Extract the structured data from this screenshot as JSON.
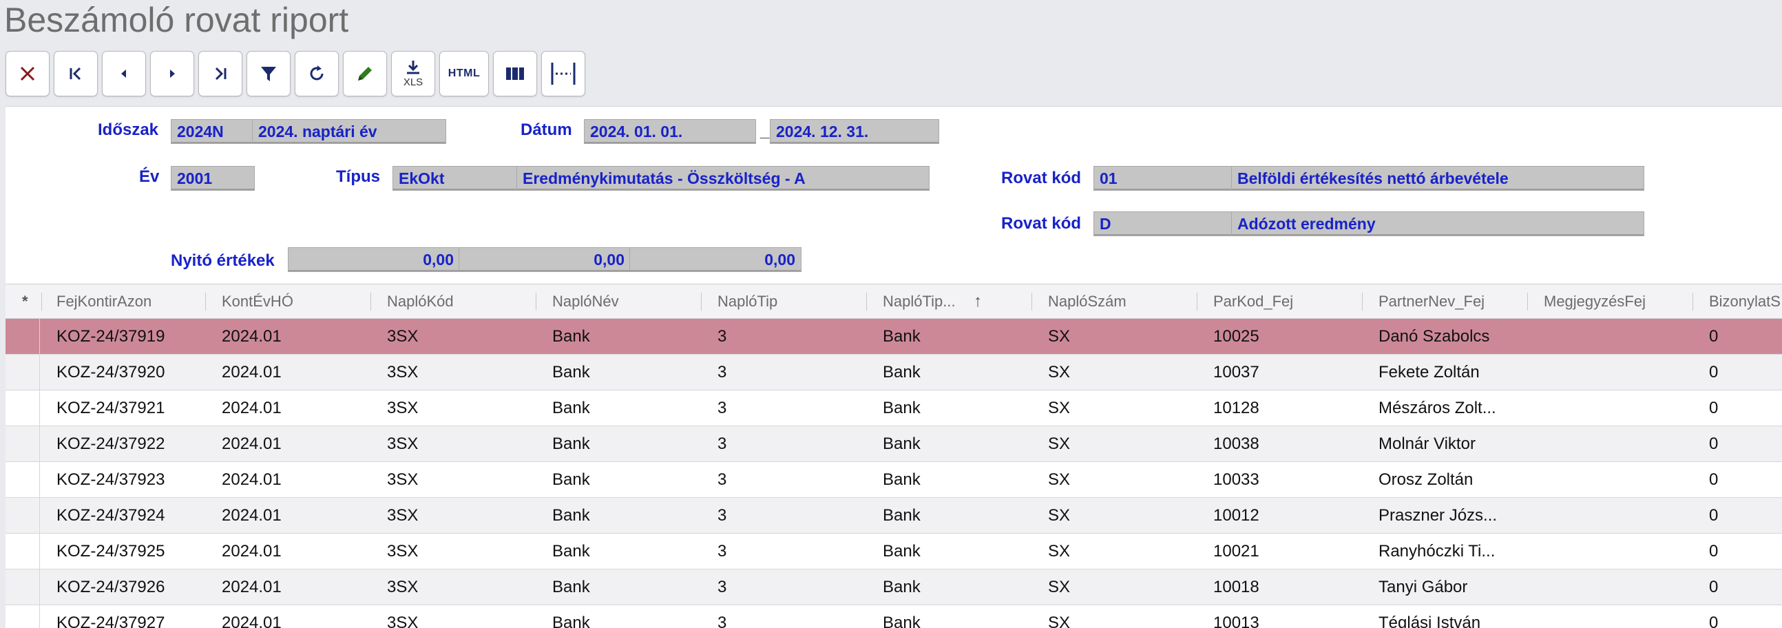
{
  "title": "Beszámoló rovat riport",
  "toolbar": {
    "buttons": [
      {
        "icon": "close-icon",
        "label": ""
      },
      {
        "icon": "first-record-icon",
        "label": ""
      },
      {
        "icon": "previous-record-icon",
        "label": ""
      },
      {
        "icon": "next-record-icon",
        "label": ""
      },
      {
        "icon": "last-record-icon",
        "label": ""
      },
      {
        "icon": "filter-icon",
        "label": ""
      },
      {
        "icon": "refresh-icon",
        "label": ""
      },
      {
        "icon": "edit-pencil-icon",
        "label": ""
      },
      {
        "icon": "download-xls-icon",
        "label": "XLS"
      },
      {
        "icon": "html-export-icon",
        "label": "HTML"
      },
      {
        "icon": "columns-icon",
        "label": ""
      },
      {
        "icon": "column-width-icon",
        "label": ""
      }
    ]
  },
  "form": {
    "idoszak_label": "Időszak",
    "idoszak_code": "2024N",
    "idoszak_name": "2024. naptári év",
    "datum_label": "Dátum",
    "datum_from": "2024. 01. 01.",
    "datum_sep": "_",
    "datum_to": "2024. 12. 31.",
    "ev_label": "Év",
    "ev_value": "2001",
    "tipus_label": "Típus",
    "tipus_code": "EkOkt",
    "tipus_name": "Eredménykimutatás - Összköltség - A",
    "rovat1_label": "Rovat kód",
    "rovat1_code": "01",
    "rovat1_name": "Belföldi értékesítés nettó árbevétele",
    "rovat2_label": "Rovat kód",
    "rovat2_code": "D",
    "rovat2_name": "Adózott eredmény",
    "nyito_label": "Nyitó értékek",
    "nyito_values": [
      "0,00",
      "0,00",
      "0,00"
    ]
  },
  "grid": {
    "marker_header": "*",
    "columns": [
      "FejKontirAzon",
      "KontÉvHÓ",
      "NaplóKód",
      "NaplóNév",
      "NaplóTip",
      "NaplóTip...",
      "NaplóSzám",
      "ParKod_Fej",
      "PartnerNev_Fej",
      "MegjegyzésFej",
      "BizonylatS"
    ],
    "sort_indicator": "↑",
    "rows": [
      [
        "KOZ-24/37919",
        "2024.01",
        "3SX",
        "Bank",
        "3",
        "Bank",
        "SX",
        "10025",
        "Danó Szabolcs",
        "",
        "0"
      ],
      [
        "KOZ-24/37920",
        "2024.01",
        "3SX",
        "Bank",
        "3",
        "Bank",
        "SX",
        "10037",
        "Fekete Zoltán",
        "",
        "0"
      ],
      [
        "KOZ-24/37921",
        "2024.01",
        "3SX",
        "Bank",
        "3",
        "Bank",
        "SX",
        "10128",
        "Mészáros Zolt...",
        "",
        "0"
      ],
      [
        "KOZ-24/37922",
        "2024.01",
        "3SX",
        "Bank",
        "3",
        "Bank",
        "SX",
        "10038",
        "Molnár Viktor",
        "",
        "0"
      ],
      [
        "KOZ-24/37923",
        "2024.01",
        "3SX",
        "Bank",
        "3",
        "Bank",
        "SX",
        "10033",
        "Orosz Zoltán",
        "",
        "0"
      ],
      [
        "KOZ-24/37924",
        "2024.01",
        "3SX",
        "Bank",
        "3",
        "Bank",
        "SX",
        "10012",
        "Praszner Józs...",
        "",
        "0"
      ],
      [
        "KOZ-24/37925",
        "2024.01",
        "3SX",
        "Bank",
        "3",
        "Bank",
        "SX",
        "10021",
        "Ranyhóczki Ti...",
        "",
        "0"
      ],
      [
        "KOZ-24/37926",
        "2024.01",
        "3SX",
        "Bank",
        "3",
        "Bank",
        "SX",
        "10018",
        "Tanyi Gábor",
        "",
        "0"
      ],
      [
        "KOZ-24/37927",
        "2024.01",
        "3SX",
        "Bank",
        "3",
        "Bank",
        "SX",
        "10013",
        "Téglási István",
        "",
        "0"
      ]
    ],
    "selected_row": 0
  },
  "colors": {
    "label_blue": "#1822c8",
    "selected_row": "#cd8897",
    "field_gray": "#c5c5c5"
  }
}
